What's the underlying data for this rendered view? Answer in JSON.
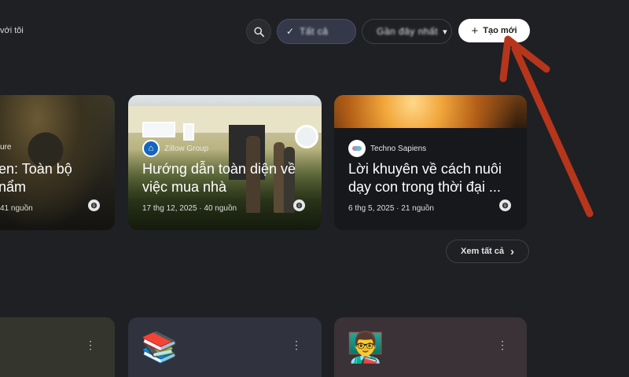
{
  "header": {
    "left_text": "với tôi",
    "view_pill_label": "Tất cả",
    "sort_pill_label": "Gần đây nhất",
    "create_button_label": "Tạo mới",
    "create_button_icon": "+"
  },
  "featured": [
    {
      "source": "ure",
      "title_line1": "en: Toàn bộ",
      "title_line2": "nẩm",
      "meta": "41 nguồn"
    },
    {
      "source": "Zillow Group",
      "title_line1": "Hướng dẫn toàn diện về",
      "title_line2": "việc mua nhà",
      "meta": "17 thg 12, 2025 · 40 nguồn"
    },
    {
      "source": "Techno Sapiens",
      "title_line1": "Lời khuyên về cách nuôi",
      "title_line2": "dạy con trong thời đại ...",
      "meta": "6 thg 5, 2025 · 21 nguồn"
    }
  ],
  "see_all_label": "Xem tất cả",
  "see_all_icon": "›",
  "notebooks": [
    {
      "emoji": ""
    },
    {
      "emoji": "📚"
    },
    {
      "emoji": "👨‍🏫"
    }
  ],
  "kebab_icon": "⋮",
  "check_icon": "✓",
  "dropdown_icon": "▾",
  "colors": {
    "background": "#1f2024",
    "annotation_arrow": "#b7361b",
    "create_button_bg": "#ffffff"
  }
}
